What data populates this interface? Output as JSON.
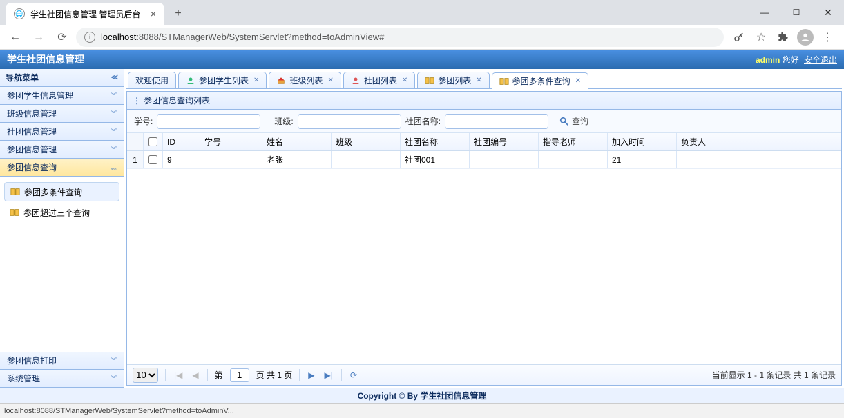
{
  "browser": {
    "tab_title": "学生社团信息管理 管理员后台",
    "url_host": "localhost",
    "url_rest": ":8088/STManagerWeb/SystemServlet?method=toAdminView#",
    "status_text": "localhost:8088/STManagerWeb/SystemServlet?method=toAdminV..."
  },
  "header": {
    "title": "学生社团信息管理",
    "admin": "admin",
    "greeting": " 您好",
    "logout": "安全退出"
  },
  "sidebar": {
    "title": "导航菜单",
    "items": [
      {
        "label": "参团学生信息管理",
        "state": "collapsed"
      },
      {
        "label": "班级信息管理",
        "state": "collapsed"
      },
      {
        "label": "社团信息管理",
        "state": "collapsed"
      },
      {
        "label": "参团信息管理",
        "state": "collapsed"
      },
      {
        "label": "参团信息查询",
        "state": "expanded"
      },
      {
        "label": "参团信息打印",
        "state": "collapsed"
      },
      {
        "label": "系统管理",
        "state": "collapsed"
      }
    ],
    "sub_items": [
      {
        "label": "参团多条件查询",
        "active": true
      },
      {
        "label": "参团超过三个查询",
        "active": false
      }
    ]
  },
  "tabs": [
    {
      "label": "欢迎使用",
      "closable": false,
      "icon": "none"
    },
    {
      "label": "参团学生列表",
      "closable": true,
      "icon": "user"
    },
    {
      "label": "班级列表",
      "closable": true,
      "icon": "home"
    },
    {
      "label": "社团列表",
      "closable": true,
      "icon": "user"
    },
    {
      "label": "参团列表",
      "closable": true,
      "icon": "book"
    },
    {
      "label": "参团多条件查询",
      "closable": true,
      "icon": "book",
      "active": true
    }
  ],
  "panel": {
    "title": "参团信息查询列表",
    "search": {
      "sid_label": "学号:",
      "class_label": "班级:",
      "club_label": "社团名称:",
      "search_btn": "查询"
    },
    "columns": [
      "",
      "",
      "ID",
      "学号",
      "姓名",
      "班级",
      "社团名称",
      "社团编号",
      "指导老师",
      "加入时间",
      "负责人"
    ],
    "rows": [
      {
        "rownum": "1",
        "id": "9",
        "sid": "",
        "name": "老张",
        "class": "",
        "club": "社团001",
        "clubid": "",
        "teacher": "",
        "join": "21",
        "leader": ""
      }
    ],
    "pager": {
      "page_size": "10",
      "page_label_pre": "第",
      "page_value": "1",
      "page_label_post": "页 共 1 页",
      "info": "当前显示 1 - 1 条记录 共 1 条记录"
    }
  },
  "footer": "Copyright © By 学生社团信息管理"
}
